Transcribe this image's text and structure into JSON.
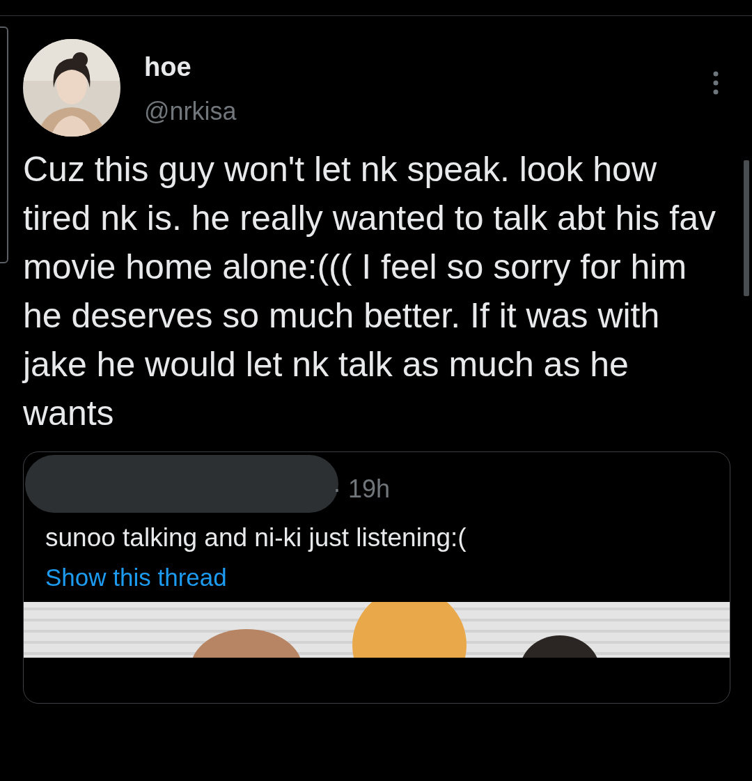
{
  "tweet": {
    "author": {
      "name": "hoe",
      "handle": "@nrkisa"
    },
    "text": "Cuz this guy won't let nk speak. look how tired nk is. he really wanted to talk abt his fav movie home alone:((( I feel so sorry for him he deserves so much better. If it was with jake he would let nk talk as much as he wants",
    "quoted": {
      "time": "· 19h",
      "text": "sunoo talking and ni-ki just listening:(",
      "link": "Show this thread"
    }
  }
}
